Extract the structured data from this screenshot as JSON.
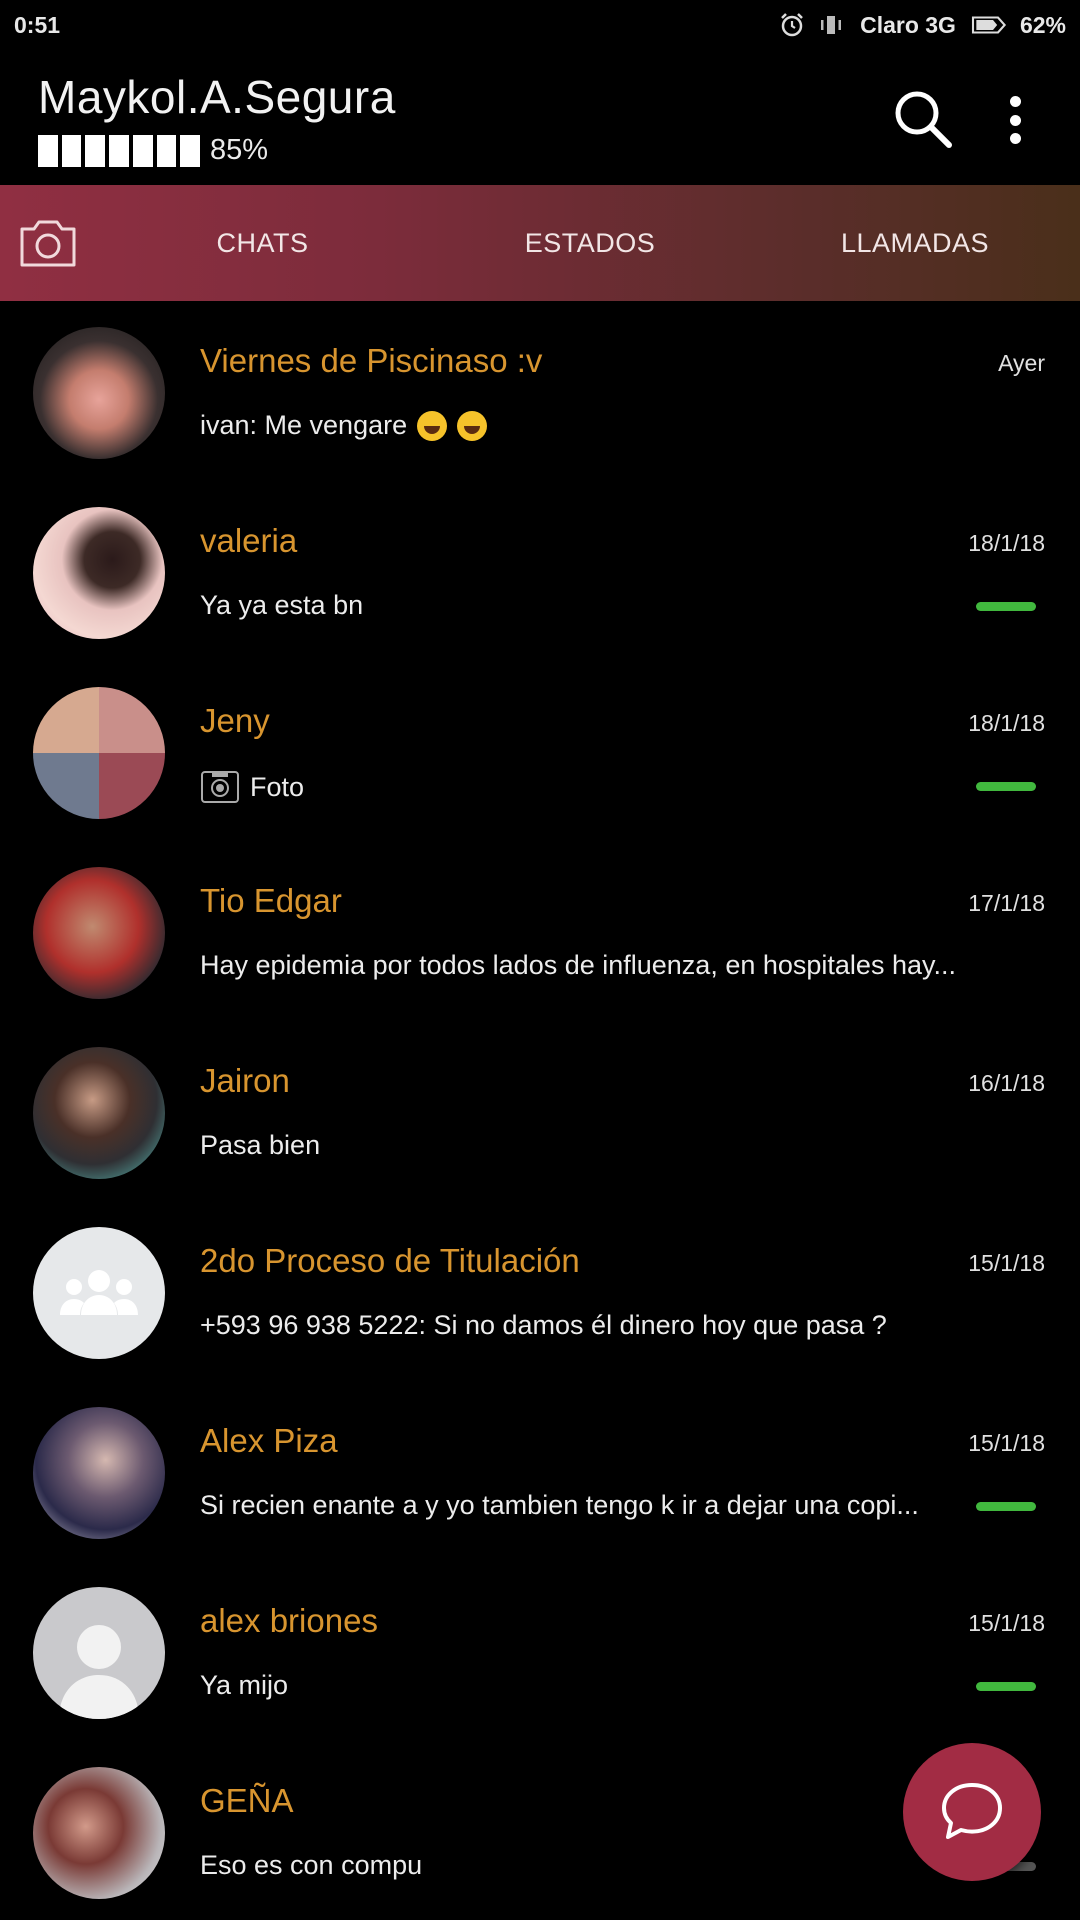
{
  "status_bar": {
    "time": "0:51",
    "carrier": "Claro 3G",
    "battery": "62%"
  },
  "header": {
    "title": "Maykol.A.Segura",
    "progress_label": "85%",
    "progress_value": 0.85,
    "search_icon": "search-icon",
    "menu_icon": "more-vert-icon"
  },
  "tabs": {
    "camera_icon": "camera-icon",
    "chats": "CHATS",
    "estados": "ESTADOS",
    "llamadas": "LLAMADAS"
  },
  "chats": [
    {
      "name": "Viernes de Piscinaso :v",
      "time": "Ayer",
      "message": "ivan: Me vengare",
      "emoji": "rofl-emoji rofl-emoji",
      "read": false
    },
    {
      "name": "valeria",
      "time": "18/1/18",
      "message": "Ya ya esta bn",
      "read": true
    },
    {
      "name": "Jeny",
      "time": "18/1/18",
      "message": "Foto",
      "photo": true,
      "read": true
    },
    {
      "name": "Tio Edgar",
      "time": "17/1/18",
      "message": "Hay epidemia por todos lados de influenza, en hospitales hay...",
      "read": false
    },
    {
      "name": "Jairon",
      "time": "16/1/18",
      "message": "Pasa bien",
      "read": false
    },
    {
      "name": "2do Proceso de Titulación",
      "time": "15/1/18",
      "message": "+593 96 938 5222: Si no  damos él dinero hoy que pasa ?",
      "read": false
    },
    {
      "name": "Alex Piza",
      "time": "15/1/18",
      "message": "Si recien enante a y yo tambien  tengo k ir a dejar una copi...",
      "read": true
    },
    {
      "name": "alex briones",
      "time": "15/1/18",
      "message": "Ya mijo",
      "read": true
    },
    {
      "name": "GEÑA",
      "time": "",
      "message": "Eso es con compu",
      "read": false
    }
  ],
  "fab": {
    "icon": "chat-bubble-icon"
  },
  "colors": {
    "accent": "#d8952f",
    "read_mark": "#41b83e",
    "fab": "#a22c44",
    "tab_gradient_start": "#902f42",
    "tab_gradient_end": "#4a2f1a"
  }
}
